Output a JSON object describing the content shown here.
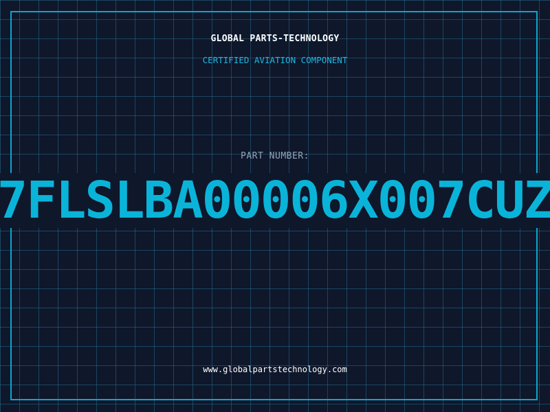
{
  "label": {
    "brand": "GLOBAL PARTS-TECHNOLOGY",
    "subtitle": "CERTIFIED AVIATION COMPONENT",
    "part_label": "PART NUMBER:",
    "part_number": "7FLSLBA00006X007CUZ",
    "website": "www.globalpartstechnology.com"
  },
  "colors": {
    "background": "#0f172b",
    "accent": "#0ab4d9",
    "grid": "#226e8c",
    "text_primary": "#ffffff",
    "text_muted": "#94a3b8"
  }
}
